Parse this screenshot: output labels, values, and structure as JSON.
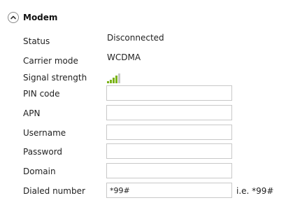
{
  "section": {
    "title": "Modem",
    "toggle_icon": "chevron-up-icon"
  },
  "rows": {
    "status": {
      "label": "Status",
      "value": "Disconnected"
    },
    "carrier_mode": {
      "label": "Carrier mode",
      "value": "WCDMA"
    },
    "signal_strength": {
      "label": "Signal strength",
      "icon": "signal-bars-icon",
      "bars_lit": 4,
      "bars_total": 5,
      "lit_color": "#7ab317",
      "unlit_color": "#c8c8c8"
    },
    "pin_code": {
      "label": "PIN code",
      "value": ""
    },
    "apn": {
      "label": "APN",
      "value": ""
    },
    "username": {
      "label": "Username",
      "value": ""
    },
    "password": {
      "label": "Password",
      "value": ""
    },
    "domain": {
      "label": "Domain",
      "value": ""
    },
    "dialed_number": {
      "label": "Dialed number",
      "value": "*99#",
      "hint": "i.e. *99#"
    }
  }
}
